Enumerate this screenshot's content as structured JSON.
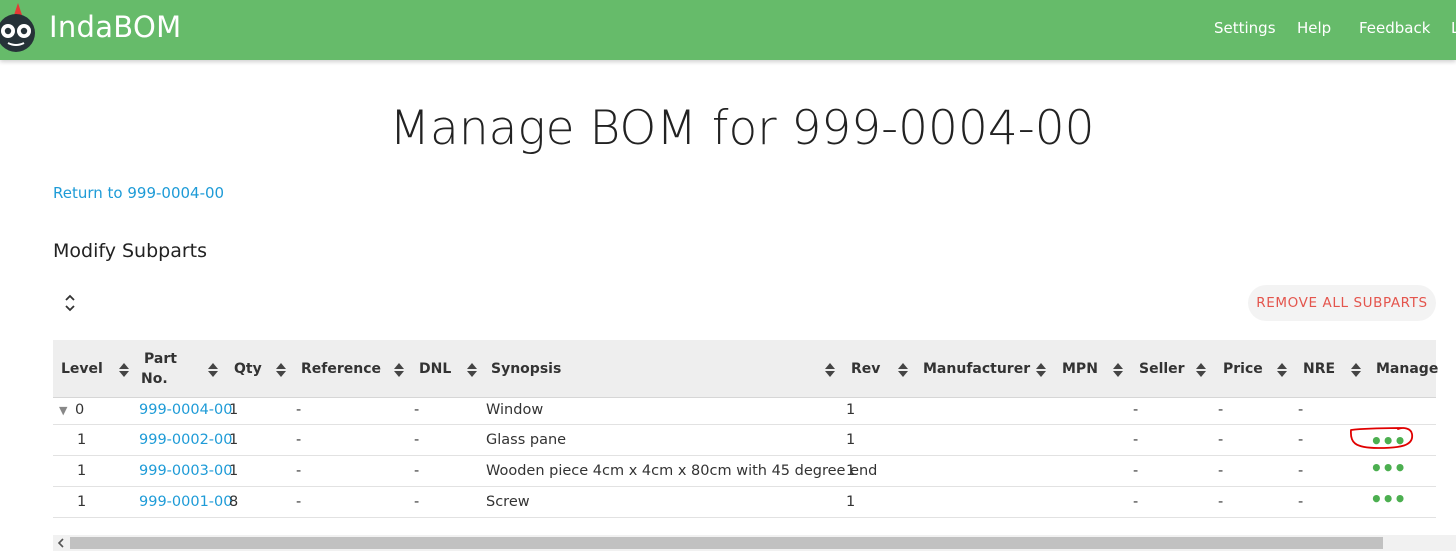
{
  "navbar": {
    "brand": "IndaBOM",
    "links": [
      "Settings",
      "Help",
      "Feedback",
      "L"
    ],
    "color": "#66bb6a"
  },
  "page": {
    "title": "Manage BOM for 999-0004-00",
    "return_link": "Return to 999-0004-00",
    "section_title": "Modify Subparts",
    "remove_all_label": "REMOVE ALL SUBPARTS"
  },
  "table": {
    "headers": {
      "level": "Level",
      "part_no_1": "Part",
      "part_no_2": "No.",
      "qty": "Qty",
      "reference": "Reference",
      "dnl": "DNL",
      "synopsis": "Synopsis",
      "rev": "Rev",
      "manufacturer": "Manufacturer",
      "mpn": "MPN",
      "seller": "Seller",
      "price": "Price",
      "nre": "NRE",
      "manage": "Manage"
    },
    "rows": [
      {
        "level": "0",
        "part_no": "999-0004-00",
        "qty": "1",
        "reference": "-",
        "dnl": "-",
        "synopsis": "Window",
        "rev": "1",
        "seller": "-",
        "price": "-",
        "nre": "-",
        "manage": ""
      },
      {
        "level": "1",
        "part_no": "999-0002-00",
        "qty": "1",
        "reference": "-",
        "dnl": "-",
        "synopsis": "Glass pane",
        "rev": "1",
        "seller": "-",
        "price": "-",
        "nre": "-",
        "manage": "•••"
      },
      {
        "level": "1",
        "part_no": "999-0003-00",
        "qty": "1",
        "reference": "-",
        "dnl": "-",
        "synopsis": "Wooden piece 4cm x 4cm x 80cm with 45 degree end",
        "rev": "1",
        "seller": "-",
        "price": "-",
        "nre": "-",
        "manage": "•••"
      },
      {
        "level": "1",
        "part_no": "999-0001-00",
        "qty": "8",
        "reference": "-",
        "dnl": "-",
        "synopsis": "Screw",
        "rev": "1",
        "seller": "-",
        "price": "-",
        "nre": "-",
        "manage": "•••"
      }
    ]
  },
  "colors": {
    "link": "#1e9bd7",
    "danger": "#e4554d",
    "manage_dots": "#4caf50",
    "annotation": "#e00000"
  }
}
